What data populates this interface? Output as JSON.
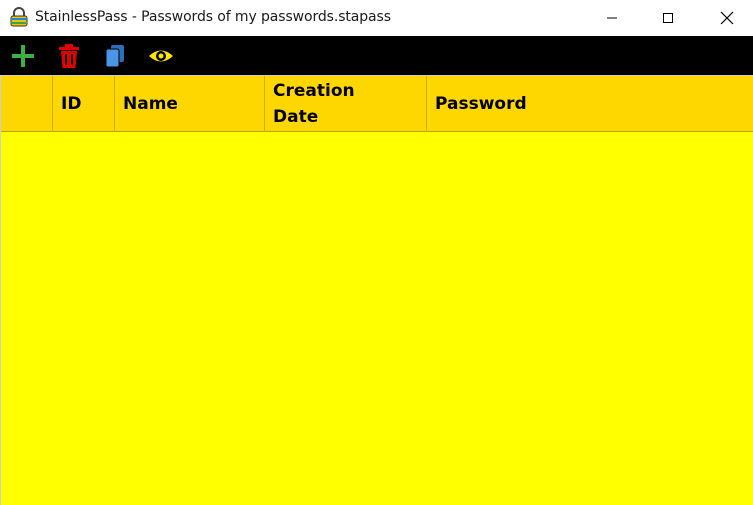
{
  "window": {
    "title": "StainlessPass - Passwords of my passwords.stapass",
    "app_icon": "padlock-icon"
  },
  "toolbar": {
    "buttons": [
      {
        "name": "add-icon",
        "color": "#3cb043"
      },
      {
        "name": "trash-icon",
        "color": "#e00000"
      },
      {
        "name": "copy-icon",
        "color": "#3a8de0"
      },
      {
        "name": "eye-icon",
        "color": "#ffe600"
      }
    ]
  },
  "grid": {
    "columns": [
      "",
      "ID",
      "Name",
      "Creation Date",
      "Password"
    ],
    "rows": [],
    "header_color": "#ffd700",
    "body_color": "#ffff00"
  }
}
